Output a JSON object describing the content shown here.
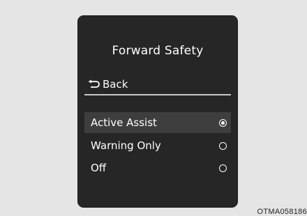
{
  "screen": {
    "title": "Forward Safety",
    "back_label": "Back",
    "back_icon": "return-arrow-icon",
    "options": [
      {
        "label": "Active Assist",
        "selected": true
      },
      {
        "label": "Warning Only",
        "selected": false
      },
      {
        "label": "Off",
        "selected": false
      }
    ]
  },
  "caption": "OTMA058186",
  "colors": {
    "background": "#e5e5e5",
    "screen": "#262626",
    "highlight": "#3e3e3e",
    "text": "#ffffff"
  }
}
